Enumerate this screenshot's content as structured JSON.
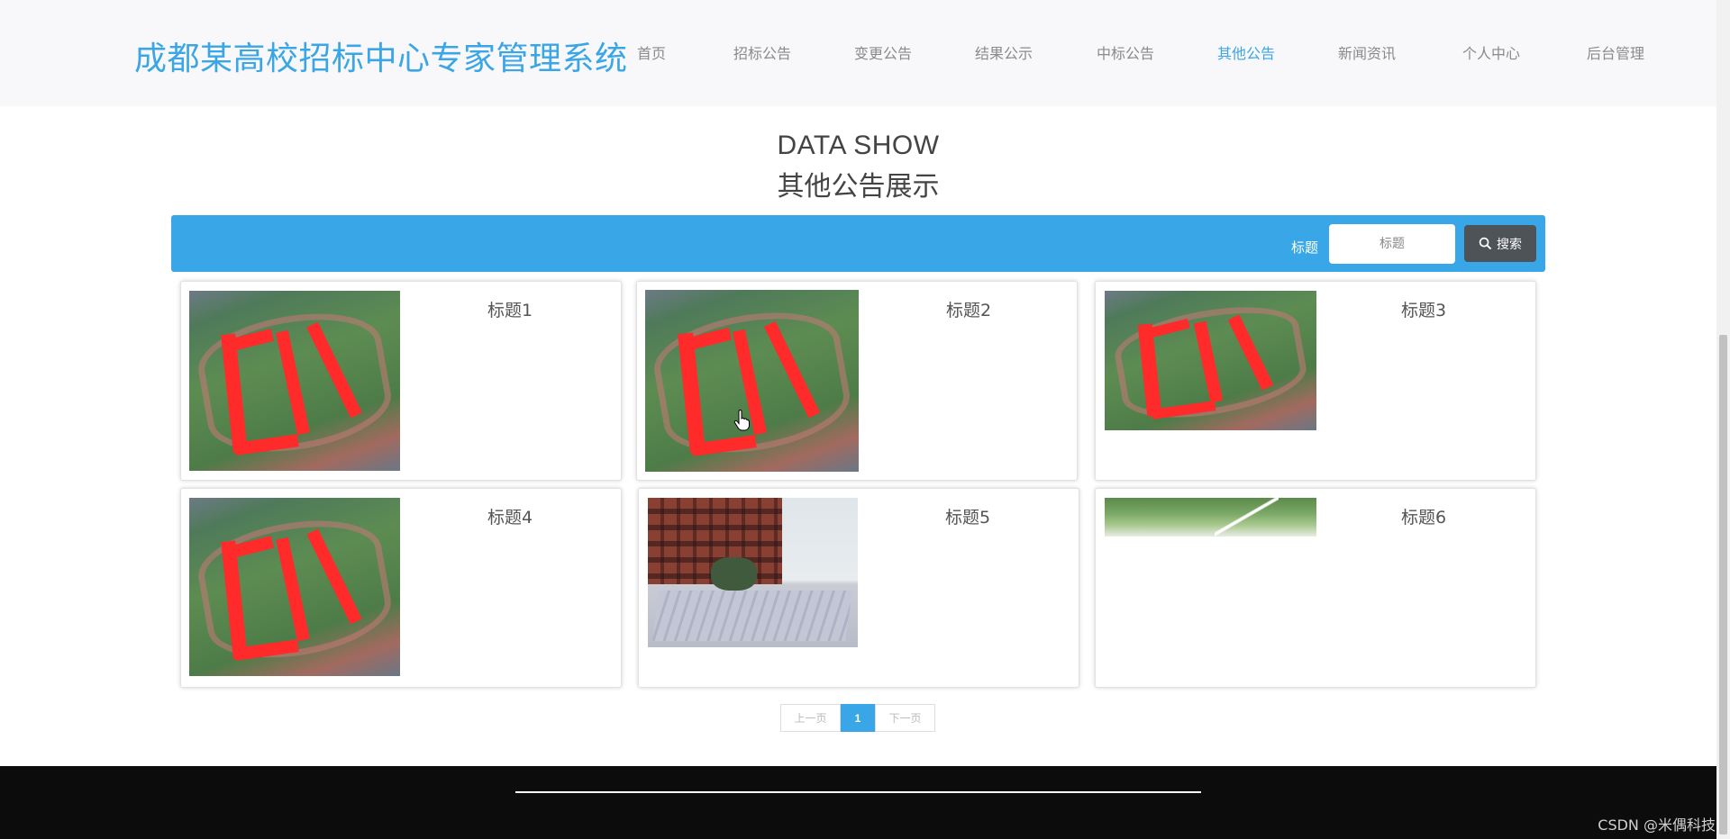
{
  "app": {
    "title": "成都某高校招标中心专家管理系统"
  },
  "nav": {
    "items": [
      {
        "label": "首页"
      },
      {
        "label": "招标公告"
      },
      {
        "label": "变更公告"
      },
      {
        "label": "结果公示"
      },
      {
        "label": "中标公告"
      },
      {
        "label": "其他公告",
        "active": true
      },
      {
        "label": "新闻资讯"
      },
      {
        "label": "个人中心"
      },
      {
        "label": "后台管理"
      }
    ]
  },
  "heading": {
    "en": "DATA SHOW",
    "cn": "其他公告展示"
  },
  "search": {
    "label": "标题",
    "placeholder": "标题",
    "button_label": "搜索",
    "button_icon": "search-icon"
  },
  "cards": [
    {
      "title": "标题1",
      "image": "field-photo"
    },
    {
      "title": "标题2",
      "image": "field-photo"
    },
    {
      "title": "标题3",
      "image": "field-photo"
    },
    {
      "title": "标题4",
      "image": "field-photo"
    },
    {
      "title": "标题5",
      "image": "building-photo"
    },
    {
      "title": "标题6",
      "image": "trees-photo"
    }
  ],
  "pagination": {
    "prev": "上一页",
    "current": "1",
    "next": "下一页"
  },
  "footer": {
    "watermark": "CSDN @米偶科技"
  },
  "colors": {
    "accent": "#38a6e7",
    "logo": "#3aa6e6",
    "header_bg": "#f8f7fa",
    "footer_bg": "#0c0c0d",
    "search_button": "#4e5357"
  }
}
